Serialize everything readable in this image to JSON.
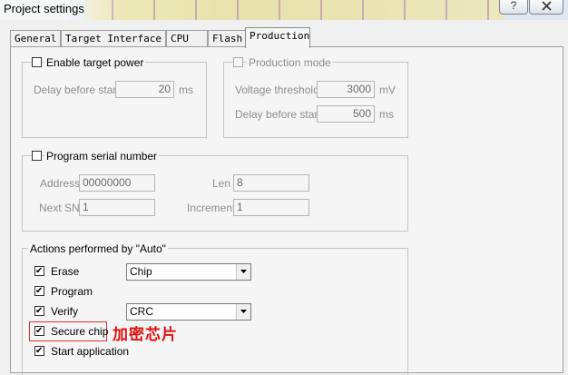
{
  "window": {
    "title": "Project settings",
    "help_label": "?",
    "close_icon": "close-x"
  },
  "tabs": [
    {
      "label": "General",
      "active": false
    },
    {
      "label": "Target Interface",
      "active": false
    },
    {
      "label": "CPU",
      "active": false
    },
    {
      "label": "Flash",
      "active": false
    },
    {
      "label": "Production",
      "active": true
    }
  ],
  "target_power": {
    "label": "Enable target power",
    "checked": false,
    "delay_label": "Delay before start",
    "delay_value": "20",
    "delay_unit": "ms"
  },
  "production_mode": {
    "label": "Production mode",
    "checked": false,
    "voltage_label": "Voltage threshold",
    "voltage_value": "3000",
    "voltage_unit": "mV",
    "delay_label": "Delay before start",
    "delay_value": "500",
    "delay_unit": "ms"
  },
  "serial": {
    "label": "Program serial number",
    "checked": false,
    "address_label": "Address",
    "address_value": "00000000",
    "len_label": "Len",
    "len_value": "8",
    "next_sn_label": "Next SN",
    "next_sn_value": "1",
    "increment_label": "Increment",
    "increment_value": "1"
  },
  "actions": {
    "label": "Actions performed by \"Auto\"",
    "erase": {
      "label": "Erase",
      "checked": true,
      "option": "Chip"
    },
    "program": {
      "label": "Program",
      "checked": true
    },
    "verify": {
      "label": "Verify",
      "checked": true,
      "option": "CRC"
    },
    "secure": {
      "label": "Secure chip",
      "checked": true
    },
    "start": {
      "label": "Start application",
      "checked": true
    }
  },
  "annotation": {
    "text": "加密芯片",
    "color": "#e01010"
  },
  "check_glyph": "✔"
}
